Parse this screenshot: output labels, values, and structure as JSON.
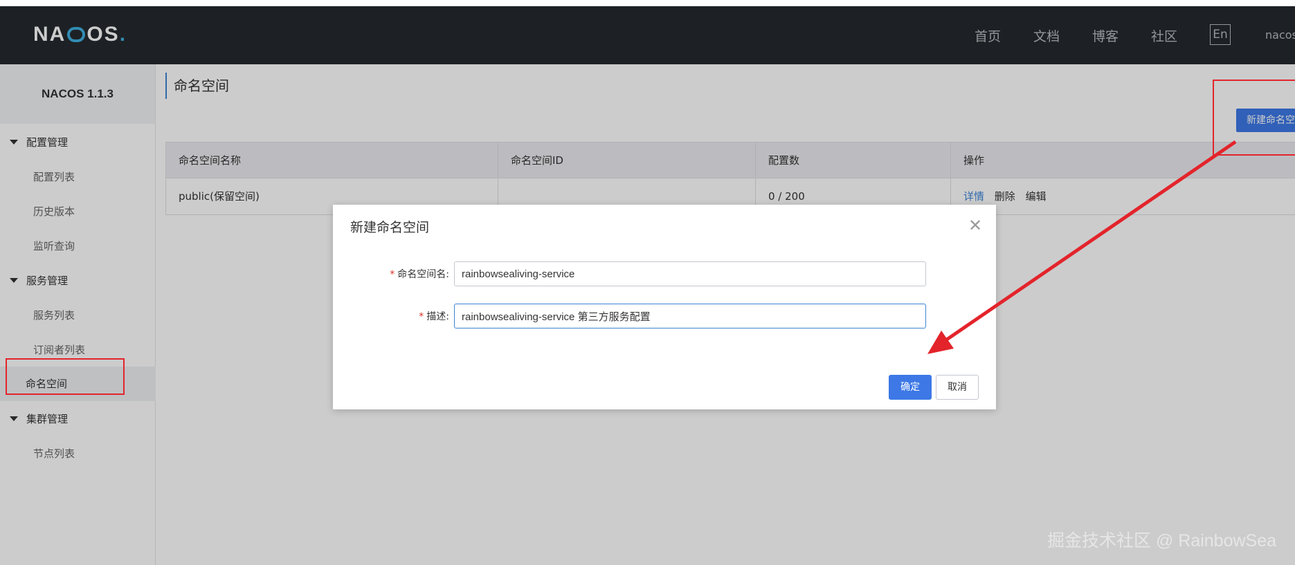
{
  "brand": {
    "logo_text": "NACOS",
    "version": "NACOS 1.1.3"
  },
  "nav": {
    "items": [
      "首页",
      "文档",
      "博客",
      "社区"
    ],
    "lang": "En",
    "user": "nacos"
  },
  "sidebar": {
    "groups": [
      {
        "label": "配置管理",
        "items": [
          "配置列表",
          "历史版本",
          "监听查询"
        ]
      },
      {
        "label": "服务管理",
        "items": [
          "服务列表",
          "订阅者列表"
        ]
      },
      {
        "label": "集群管理",
        "items": [
          "节点列表"
        ]
      }
    ],
    "active_item": "命名空间"
  },
  "page": {
    "title": "命名空间",
    "create_button": "新建命名空间"
  },
  "table": {
    "headers": [
      "命名空间名称",
      "命名空间ID",
      "配置数",
      "操作"
    ],
    "rows": [
      {
        "name": "public(保留空间)",
        "id": "",
        "count": "0 / 200",
        "ops": [
          "详情",
          "删除",
          "编辑"
        ]
      }
    ]
  },
  "dialog": {
    "title": "新建命名空间",
    "close_glyph": "✕",
    "fields": [
      {
        "label": "命名空间名:",
        "value": "rainbowsealiving-service"
      },
      {
        "label": "描述:",
        "value": "rainbowsealiving-service 第三方服务配置"
      }
    ],
    "ok_label": "确定",
    "cancel_label": "取消"
  },
  "annotation_color": "#e3242b",
  "watermark": "掘金技术社区 @ RainbowSea"
}
